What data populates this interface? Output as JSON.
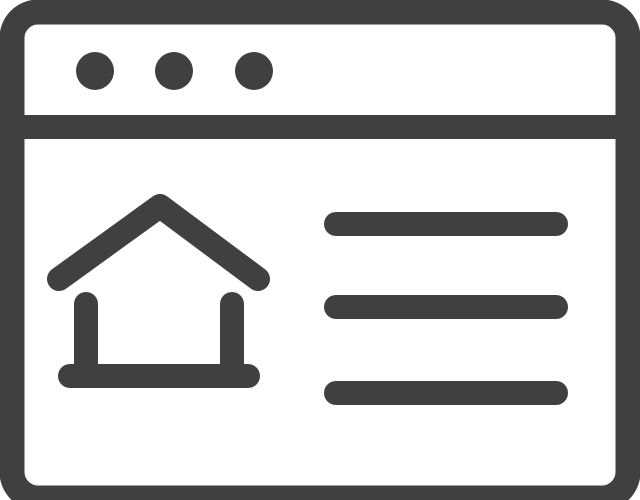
{
  "colors": {
    "stroke": "#404040",
    "background": "#ffffff"
  },
  "icons": {
    "window": "browser-window-icon",
    "home": "house-icon",
    "content": "text-lines-icon"
  },
  "window_controls": [
    "dot",
    "dot",
    "dot"
  ],
  "content_lines": 3
}
